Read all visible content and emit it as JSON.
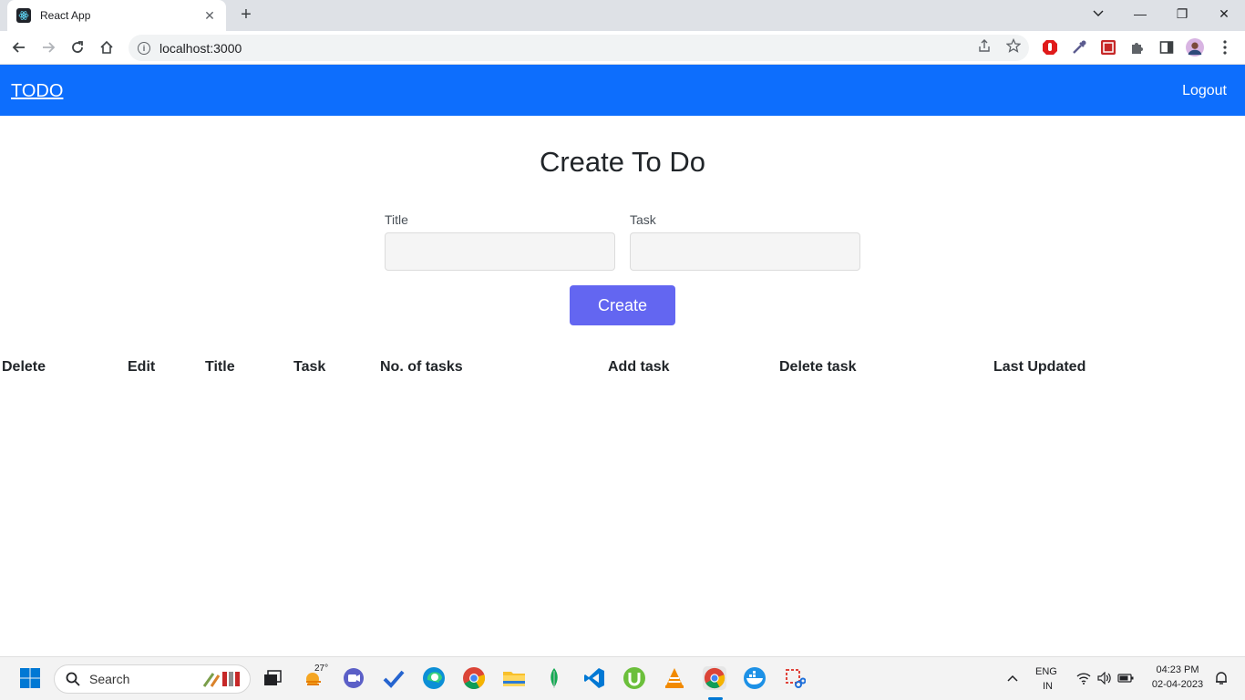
{
  "browser": {
    "tab_title": "React App",
    "tab_close": "✕",
    "new_tab": "+",
    "url": "localhost:3000",
    "window_controls": {
      "minimize": "—",
      "restore": "❐",
      "close": "✕"
    }
  },
  "navbar": {
    "brand": "TODO",
    "logout": "Logout"
  },
  "form": {
    "heading": "Create To Do",
    "title_label": "Title",
    "title_value": "",
    "task_label": "Task",
    "task_value": "",
    "create_button": "Create"
  },
  "table": {
    "headers": [
      "Delete",
      "Edit",
      "Title",
      "Task",
      "No. of tasks",
      "Add task",
      "Delete task",
      "Last Updated"
    ],
    "rows": []
  },
  "taskbar": {
    "search_label": "Search",
    "weather_temp": "27°",
    "language_line1": "ENG",
    "language_line2": "IN",
    "time": "04:23 PM",
    "date": "02-04-2023"
  },
  "colors": {
    "navbar_bg": "#0d6efd",
    "create_button_bg": "#6366f1"
  }
}
